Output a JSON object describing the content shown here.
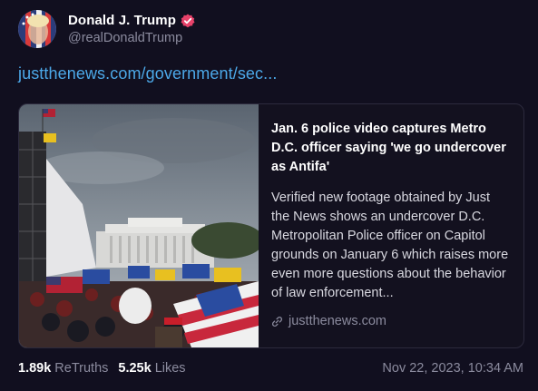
{
  "author": {
    "display_name": "Donald J. Trump",
    "handle": "@realDonaldTrump",
    "verified_color": "#e8426a"
  },
  "post": {
    "link_text": "justthenews.com/government/sec..."
  },
  "card": {
    "title": "Jan. 6 police video captures Metro D.C. officer saying 'we go undercover as Antifa'",
    "description": "Verified new footage obtained by Just the News shows an undercover D.C. Metropolitan Police officer on Capitol grounds on January 6 which raises more even more questions about the behavior of law enforcement...",
    "domain": "justthenews.com",
    "image_icon": "capitol-crowd-photo"
  },
  "stats": {
    "retruths_count": "1.89k",
    "retruths_label": "ReTruths",
    "likes_count": "5.25k",
    "likes_label": "Likes",
    "timestamp": "Nov 22, 2023, 10:34 AM"
  },
  "colors": {
    "background": "#110f1f",
    "link": "#4ca8e8",
    "muted": "#8b8b9e",
    "border": "#2c2a3d"
  }
}
